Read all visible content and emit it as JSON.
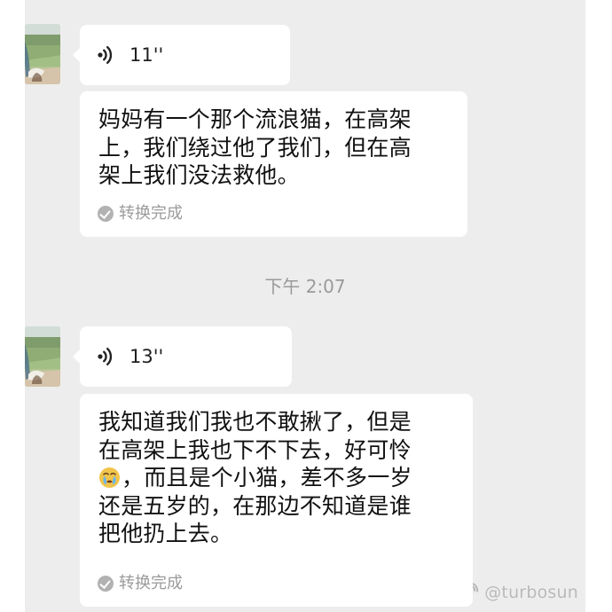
{
  "messages": [
    {
      "type": "voice",
      "duration": "11''"
    },
    {
      "type": "transcription",
      "lines": [
        "妈妈有一个那个流浪猫，在高架",
        "上，我们绕过他了我们，但在高",
        "架上我们没法救他。"
      ],
      "status": "转换完成"
    },
    {
      "type": "voice",
      "duration": "13''"
    },
    {
      "type": "transcription",
      "lines": [
        "我知道我们我也不敢揪了，但是",
        "在高架上我也下不下去，好可怜",
        "，而且是个小猫，差不多一岁",
        "还是五岁的，在那边不知道是谁",
        "把他扔上去。"
      ],
      "emoji_icon": "crying-face-icon",
      "status": "转换完成"
    }
  ],
  "timestamp": "下午 2:07",
  "watermark": {
    "icon": "weibo-icon",
    "handle": "@turbosun"
  },
  "icons": {
    "voice": "voice-wave-icon",
    "status": "check-circle-icon",
    "avatar": "avatar"
  },
  "colors": {
    "chat_background": "#ededed",
    "bubble_background": "#ffffff",
    "timestamp_text": "#9a9a9a",
    "status_text": "#9b9b9b"
  }
}
